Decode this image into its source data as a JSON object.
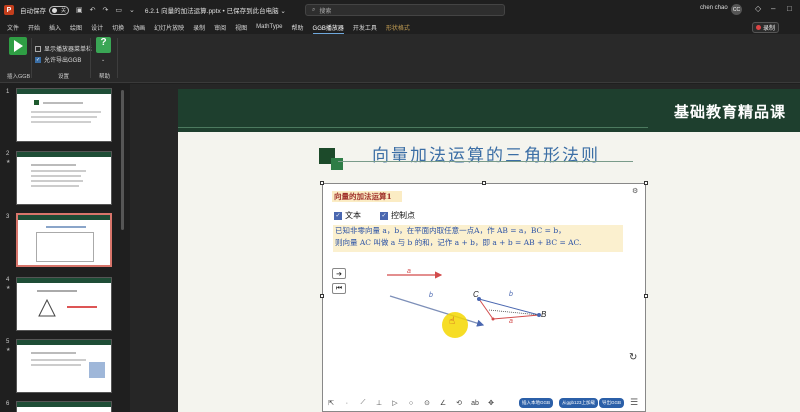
{
  "titlebar": {
    "app_icon": "P",
    "autosave_label": "自动保存",
    "autosave_state": "关",
    "filename": "6.2.1 向量的加法运算.pptx • 已保存到此台电脑 ⌄",
    "search_placeholder": "搜索",
    "user_name": "chen chao",
    "avatar_initials": "CC"
  },
  "menubar": {
    "items": [
      "文件",
      "开始",
      "插入",
      "绘图",
      "设计",
      "切换",
      "动画",
      "幻灯片放映",
      "录制",
      "审阅",
      "视图",
      "MathType",
      "帮助",
      "GGB播放器",
      "开发工具",
      "形状格式"
    ],
    "active_index": 13,
    "record_label": "录制"
  },
  "ribbon": {
    "insert_label": "插入GGB",
    "settings_label": "设置",
    "help_label": "帮助",
    "option1": "显示播放器菜单栏",
    "option2": "允许导出GGB",
    "accent": "#2f9e44"
  },
  "thumbnails": {
    "numbers": [
      "1",
      "2",
      "3",
      "4",
      "5",
      "6"
    ],
    "selected": 3
  },
  "slide": {
    "header_text": "基础教育精品课",
    "title": "向量加法运算的三角形法则",
    "applet": {
      "title": "向量的加法运算1",
      "check_text": "文本",
      "check_points": "控制点",
      "line1": "已知非零向量 a，b，在平面内取任意一点A，作 AB = a，BC = b，",
      "line2": "则向量 AC 叫做 a 与 b 的和，记作 a + b，即 a + b = AB + BC = AC.",
      "label_a": "a",
      "label_b": "b",
      "label_A": "A",
      "label_B": "B",
      "label_C": "C",
      "btn_local": "插入本地GGB",
      "btn_ggb123": "从ggb123上加载",
      "btn_export": "导出GGB"
    }
  }
}
